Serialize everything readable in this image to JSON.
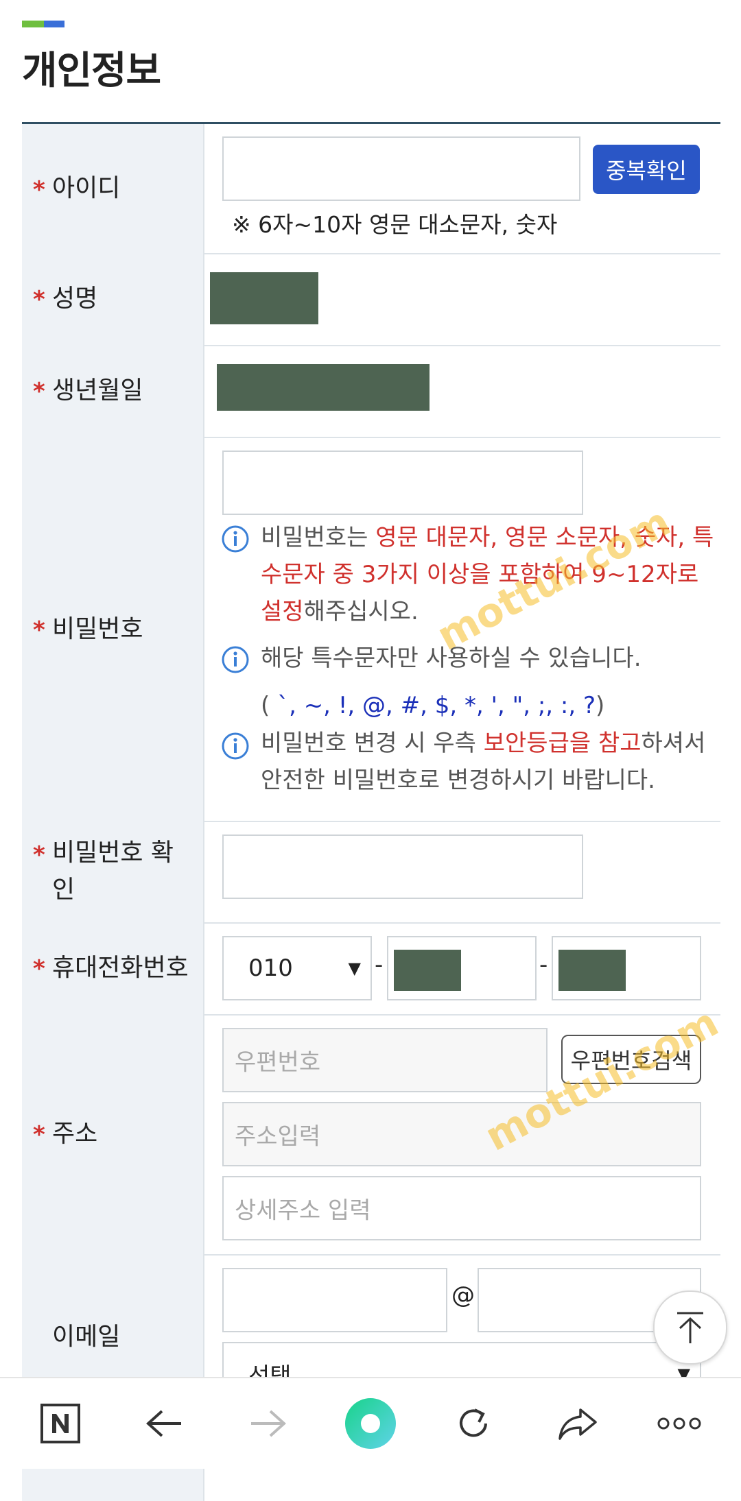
{
  "page": {
    "title": "개인정보"
  },
  "watermark": "mottui.com",
  "form": {
    "required_mark": "*",
    "id": {
      "label": "아이디",
      "button": "중복확인",
      "note": "※ 6자~10자 영문 대소문자, 숫자"
    },
    "name": {
      "label": "성명"
    },
    "birth": {
      "label": "생년월일"
    },
    "password": {
      "label": "비밀번호",
      "rule_prefix": "비밀번호는 ",
      "rule_highlight": "영문 대문자, 영문 소문자, 숫자, 특수문자 중 3가지 이상을 포함하여 9~12자로 설정",
      "rule_suffix": "해주십시오.",
      "special_intro": "해당 특수문자만 사용하실 수 있습니다.",
      "special_open": "(",
      "special_chars": " `,  ~,  !,  @,  #,  $,  *,  ',  \",  ;,  :,  ?",
      "special_close": ")",
      "change_prefix": "비밀번호 변경 시 우측 ",
      "change_highlight": "보안등급을 참고",
      "change_suffix": "하셔서",
      "change_line2": "안전한 비밀번호로 변경하시기 바랍니다."
    },
    "password_confirm": {
      "label_line1": "비밀번호 확",
      "label_line2": "인"
    },
    "phone": {
      "label": "휴대전화번호",
      "prefix_value": "010",
      "separator": "-"
    },
    "address": {
      "label": "주소",
      "zip_placeholder": "우편번호",
      "zip_button": "우편번호검색",
      "addr_placeholder": "주소입력",
      "detail_placeholder": "상세주소 입력"
    },
    "email": {
      "label": "이메일",
      "at": "@",
      "domain_select": "선택"
    }
  },
  "bottom_nav": [
    "naver-home-icon",
    "back-arrow-icon",
    "forward-arrow-icon",
    "green-dot-icon",
    "refresh-icon",
    "share-icon",
    "more-icon"
  ],
  "colors": {
    "primary": "#2a56c6",
    "required": "#d0312d",
    "label_bg": "#eef2f6",
    "masked": "#4e6452"
  }
}
